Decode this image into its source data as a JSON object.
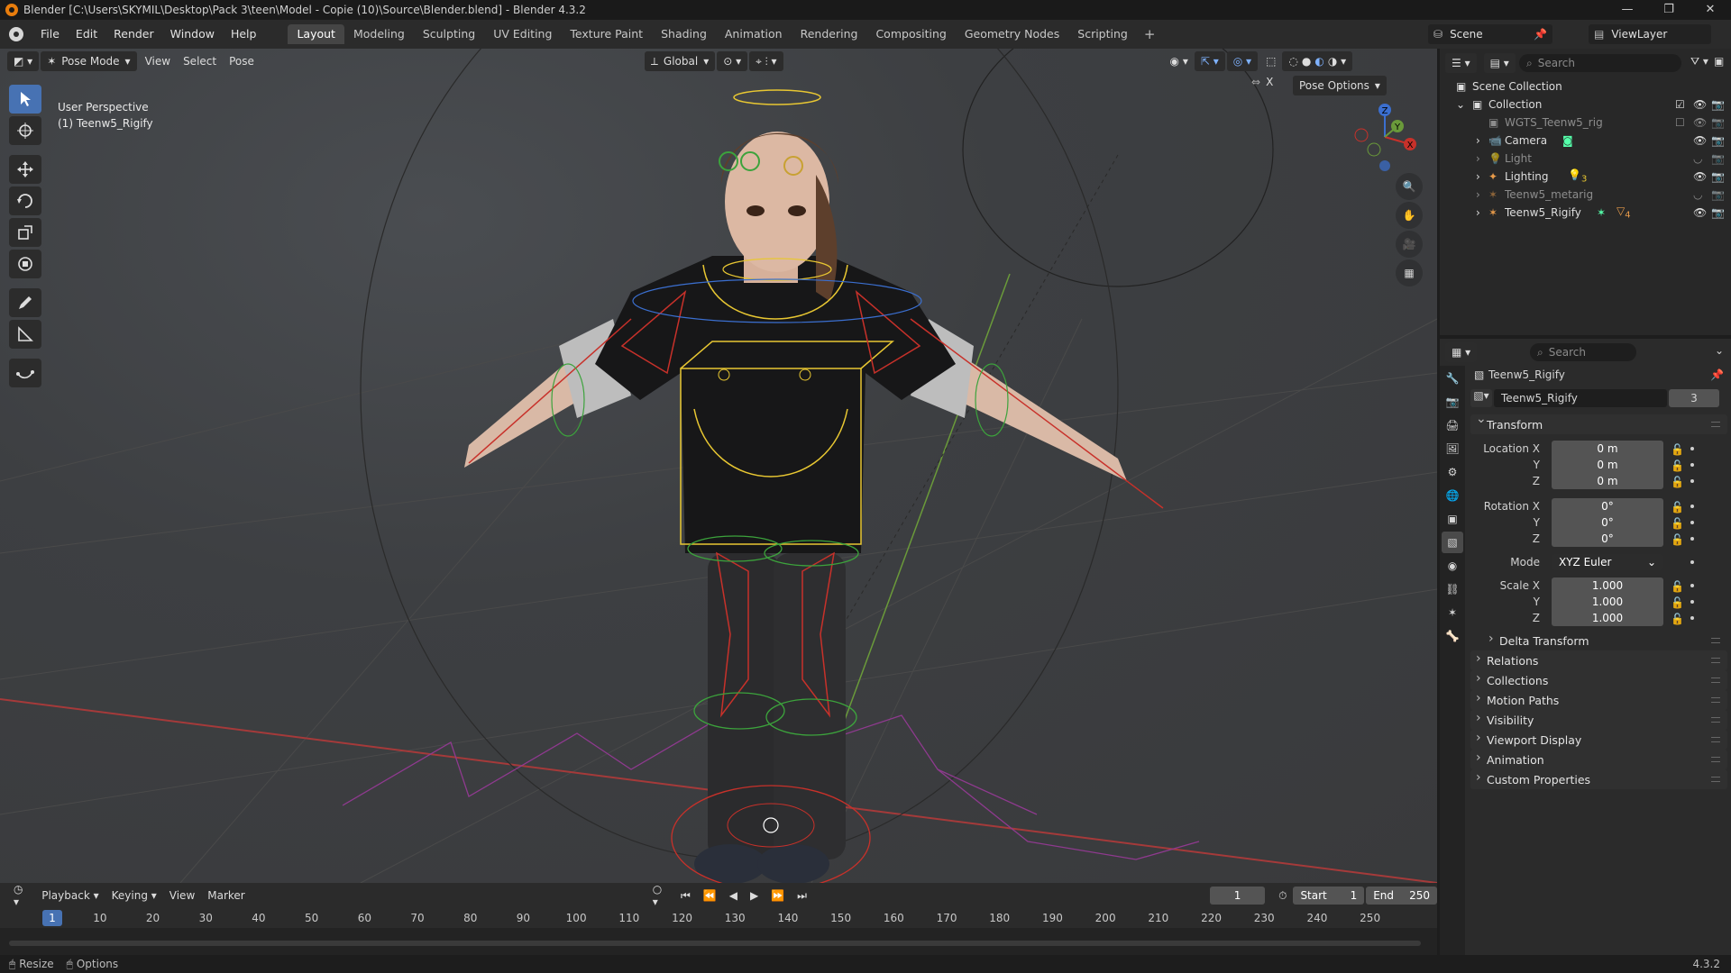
{
  "window": {
    "title": "Blender [C:\\Users\\SKYMIL\\Desktop\\Pack 3\\teen\\Model - Copie (10)\\Source\\Blender.blend] - Blender 4.3.2",
    "version": "4.3.2"
  },
  "menu": [
    "File",
    "Edit",
    "Render",
    "Window",
    "Help"
  ],
  "workspaces": [
    "Layout",
    "Modeling",
    "Sculpting",
    "UV Editing",
    "Texture Paint",
    "Shading",
    "Animation",
    "Rendering",
    "Compositing",
    "Geometry Nodes",
    "Scripting"
  ],
  "active_workspace": "Layout",
  "scene": {
    "name": "Scene",
    "view_layer": "ViewLayer"
  },
  "viewport": {
    "mode": "Pose Mode",
    "menus": [
      "View",
      "Select",
      "Pose"
    ],
    "orientation": "Global",
    "pose_options": "Pose Options",
    "perspective_label": "User Perspective",
    "active_object_label": "(1) Teenw5_Rigify",
    "axis_x": "X",
    "axis_y": "Y",
    "axis_z": "Z"
  },
  "outliner": {
    "search_placeholder": "Search",
    "scene_collection": "Scene Collection",
    "collection": "Collection",
    "items": [
      {
        "name": "WGTS_Teenw5_rig",
        "dim": true
      },
      {
        "name": "Camera",
        "dim": false
      },
      {
        "name": "Light",
        "dim": true
      },
      {
        "name": "Lighting",
        "dim": false,
        "badge": "3"
      },
      {
        "name": "Teenw5_metarig",
        "dim": true
      },
      {
        "name": "Teenw5_Rigify",
        "dim": false,
        "badge": "4"
      }
    ]
  },
  "properties": {
    "search_placeholder": "Search",
    "object_name": "Teenw5_Rigify",
    "datablock_name": "Teenw5_Rigify",
    "users": "3",
    "transform_title": "Transform",
    "location_label": "Location X",
    "rotation_label": "Rotation X",
    "scale_label": "Scale X",
    "y_label": "Y",
    "z_label": "Z",
    "location": [
      "0 m",
      "0 m",
      "0 m"
    ],
    "rotation": [
      "0°",
      "0°",
      "0°"
    ],
    "mode_label": "Mode",
    "mode_value": "XYZ Euler",
    "scale": [
      "1.000",
      "1.000",
      "1.000"
    ],
    "delta_transform": "Delta Transform",
    "panels": [
      "Relations",
      "Collections",
      "Motion Paths",
      "Visibility",
      "Viewport Display",
      "Animation",
      "Custom Properties"
    ]
  },
  "timeline": {
    "menus": [
      "Playback",
      "Keying",
      "View",
      "Marker"
    ],
    "current_frame": "1",
    "start_label": "Start",
    "start": "1",
    "end_label": "End",
    "end": "250",
    "ticks": [
      "10",
      "20",
      "30",
      "40",
      "50",
      "60",
      "70",
      "80",
      "90",
      "100",
      "110",
      "120",
      "130",
      "140",
      "150",
      "160",
      "170",
      "180",
      "190",
      "200",
      "210",
      "220",
      "230",
      "240",
      "250"
    ],
    "playhead": "1"
  },
  "status": {
    "resize": "Resize",
    "options": "Options",
    "version": "4.3.2"
  },
  "colors": {
    "accent": "#4772b3",
    "active_tab": "#454545",
    "bone_yellow": "#e8c732",
    "bone_red": "#c8312a",
    "bone_green": "#3ca33c"
  }
}
